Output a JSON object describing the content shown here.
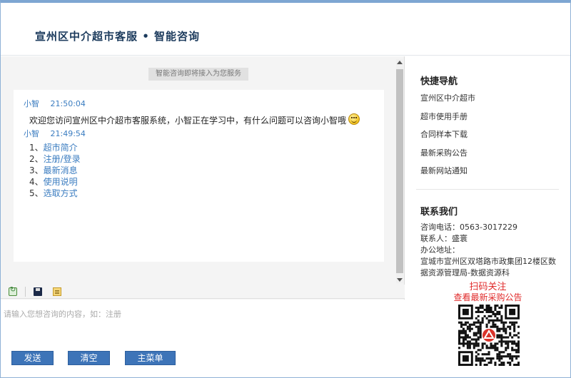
{
  "header": {
    "title": "宣州区中介超市客服 • 智能咨询"
  },
  "notice": "智能咨询即将接入为您服务",
  "messages": [
    {
      "sender": "小智",
      "time": "21:50:04",
      "text": "欢迎您访问宣州区中介超市客服系统，小智正在学习中，有什么问题可以咨询小智哦"
    },
    {
      "sender": "小智",
      "time": "21:49:54",
      "menu": [
        {
          "num": "1、",
          "label": "超市简介"
        },
        {
          "num": "2、",
          "label": "注册/登录"
        },
        {
          "num": "3、",
          "label": "最新消息"
        },
        {
          "num": "4、",
          "label": "使用说明"
        },
        {
          "num": "5、",
          "label": "选取方式"
        }
      ]
    }
  ],
  "input": {
    "placeholder": "请输入您想咨询的内容，如：注册",
    "value": ""
  },
  "buttons": {
    "send": "发送",
    "clear": "清空",
    "main_menu": "主菜单"
  },
  "quick_nav": {
    "title": "快捷导航",
    "items": [
      "宣州区中介超市",
      "超市使用手册",
      "合同样本下载",
      "最新采购公告",
      "最新网站通知"
    ]
  },
  "contact": {
    "title": "联系我们",
    "phone_label": "咨询电话：",
    "phone": "0563-3017229",
    "person_label": "联系人：",
    "person": "盛寰",
    "address_label": "办公地址：",
    "address": "宣城市宣州区双塔路市政集团12楼区数据资源管理局-数据资源科"
  },
  "qr": {
    "title": "扫码关注",
    "subtitle": "查看最新采购公告"
  },
  "colors": {
    "accent": "#3d74b8",
    "link": "#3a7cc0",
    "alert": "#e02a2a"
  }
}
